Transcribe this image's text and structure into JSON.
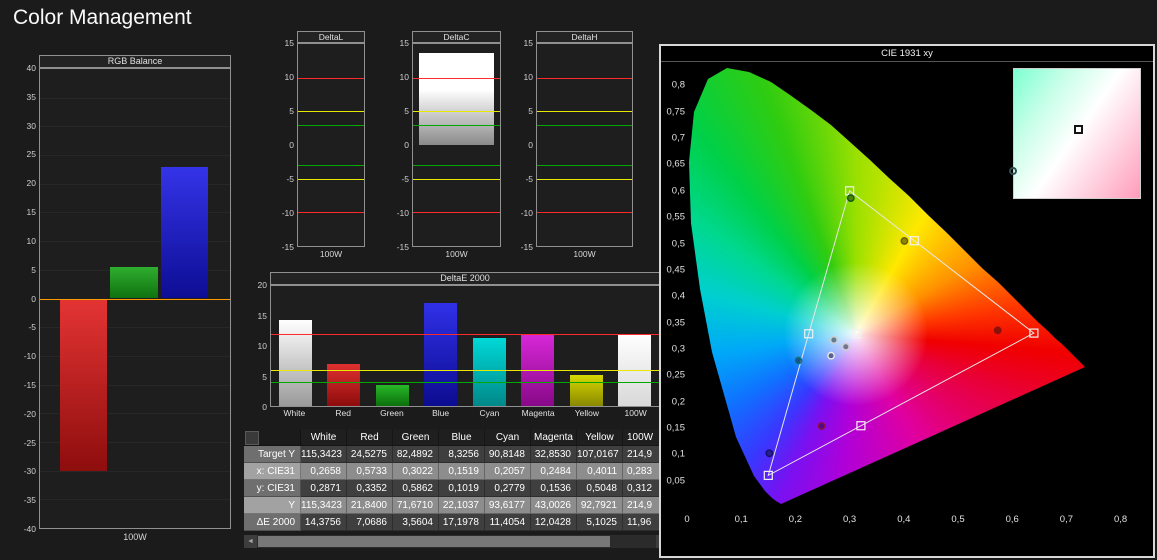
{
  "page_title": "Color Management",
  "colors": {
    "background": "#1b1b1b",
    "panel_border": "#909090",
    "cie_border": "#d8d8d8",
    "zero_line": "#ff9900",
    "limit_red": "#ff2a2a",
    "limit_yellow": "#e8e800",
    "limit_green": "#00a800"
  },
  "rgb_balance": {
    "title": "RGB Balance",
    "x_label": "100W",
    "y_max": 40,
    "y_min": -40,
    "y_step": 5,
    "bars": [
      {
        "name": "red",
        "value": -30,
        "color_light": "#e43434",
        "color_dark": "#8e0d0d"
      },
      {
        "name": "green",
        "value": 5.5,
        "color_light": "#2fae2f",
        "color_dark": "#107110"
      },
      {
        "name": "blue",
        "value": 23,
        "color_light": "#3434e8",
        "color_dark": "#0d0d94"
      }
    ]
  },
  "delta_charts": [
    {
      "title": "DeltaL",
      "x_label": "100W",
      "y_max": 15,
      "y_min": -15,
      "y_step": 5,
      "value": 0,
      "bar_color": [
        "#ffffff",
        "#909090"
      ],
      "thresholds": {
        "red": 10,
        "yellow": 5,
        "green": 3
      }
    },
    {
      "title": "DeltaC",
      "x_label": "100W",
      "y_max": 15,
      "y_min": -15,
      "y_step": 5,
      "value": 13.7,
      "bar_color": [
        "#ffffff",
        "#8a8a8a"
      ],
      "thresholds": {
        "red": 10,
        "yellow": 5,
        "green": 3
      }
    },
    {
      "title": "DeltaH",
      "x_label": "100W",
      "y_max": 15,
      "y_min": -15,
      "y_step": 5,
      "value": 0,
      "bar_color": [
        "#ffffff",
        "#909090"
      ],
      "thresholds": {
        "red": 10,
        "yellow": 5,
        "green": 3
      }
    }
  ],
  "delta_e_chart": {
    "title": "DeltaE 2000",
    "y_max": 20,
    "y_min": 0,
    "y_step": 5,
    "thresholds": {
      "red": 12,
      "yellow": 6,
      "green": 4
    },
    "categories": [
      "White",
      "Red",
      "Green",
      "Blue",
      "Cyan",
      "Magenta",
      "Yellow",
      "100W"
    ],
    "values": [
      14.3756,
      7.0686,
      3.5604,
      17.1978,
      11.4054,
      12.0428,
      5.1025,
      11.96
    ],
    "bar_colors": [
      [
        "#ffffff",
        "#9a9a9a"
      ],
      [
        "#e03030",
        "#8d0c0c"
      ],
      [
        "#28b828",
        "#0c700c"
      ],
      [
        "#3030e8",
        "#0c0c90"
      ],
      [
        "#00d8d8",
        "#008888"
      ],
      [
        "#d828d8",
        "#880888"
      ],
      [
        "#d8d800",
        "#888800"
      ],
      [
        "#ffffff",
        "#d8d8d8"
      ]
    ]
  },
  "table": {
    "columns": [
      "",
      "White",
      "Red",
      "Green",
      "Blue",
      "Cyan",
      "Magenta",
      "Yellow",
      "100W"
    ],
    "rows": [
      {
        "label": "Target Y",
        "values": [
          "115,3423",
          "24,5275",
          "82,4892",
          "8,3256",
          "90,8148",
          "32,8530",
          "107,0167",
          "214,9"
        ]
      },
      {
        "label": "x: CIE31",
        "values": [
          "0,2658",
          "0,5733",
          "0,3022",
          "0,1519",
          "0,2057",
          "0,2484",
          "0,4011",
          "0,283"
        ]
      },
      {
        "label": "y: CIE31",
        "values": [
          "0,2871",
          "0,3352",
          "0,5862",
          "0,1019",
          "0,2779",
          "0,1536",
          "0,5048",
          "0,312"
        ]
      },
      {
        "label": "Y",
        "values": [
          "115,3423",
          "21,8400",
          "71,6710",
          "22,1037",
          "93,6177",
          "43,0026",
          "92,7921",
          "214,9"
        ]
      },
      {
        "label": "ΔE 2000",
        "values": [
          "14,3756",
          "7,0686",
          "3,5604",
          "17,1978",
          "11,4054",
          "12,0428",
          "5,1025",
          "11,96"
        ]
      }
    ]
  },
  "cie_chart": {
    "title": "CIE 1931 xy",
    "x_ticks": [
      "0",
      "0,1",
      "0,2",
      "0,3",
      "0,4",
      "0,5",
      "0,6",
      "0,7",
      "0,8"
    ],
    "y_ticks": [
      "0,8",
      "0,75",
      "0,7",
      "0,65",
      "0,6",
      "0,55",
      "0,5",
      "0,45",
      "0,4",
      "0,35",
      "0,3",
      "0,25",
      "0,2",
      "0,15",
      "0,1",
      "0,05"
    ],
    "gamut_triangle": {
      "red": [
        0.64,
        0.33
      ],
      "green": [
        0.3,
        0.6
      ],
      "blue": [
        0.15,
        0.06
      ]
    },
    "reference_points": [
      {
        "name": "White",
        "x": 0.3127,
        "y": 0.329
      },
      {
        "name": "Red",
        "x": 0.64,
        "y": 0.33
      },
      {
        "name": "Green",
        "x": 0.3,
        "y": 0.6
      },
      {
        "name": "Blue",
        "x": 0.15,
        "y": 0.06
      },
      {
        "name": "Cyan",
        "x": 0.2246,
        "y": 0.3287
      },
      {
        "name": "Magenta",
        "x": 0.3209,
        "y": 0.1542
      },
      {
        "name": "Yellow",
        "x": 0.4193,
        "y": 0.5053
      }
    ],
    "measured_points": [
      {
        "name": "White",
        "x": 0.2658,
        "y": 0.2871,
        "color": "#e8e8e8"
      },
      {
        "name": "Red",
        "x": 0.5733,
        "y": 0.3352,
        "color": "#8d1010"
      },
      {
        "name": "Green",
        "x": 0.3022,
        "y": 0.5862,
        "color": "#0a5c0a"
      },
      {
        "name": "Blue",
        "x": 0.1519,
        "y": 0.1019,
        "color": "#10106a"
      },
      {
        "name": "Cyan",
        "x": 0.2057,
        "y": 0.2779,
        "color": "#0a7878"
      },
      {
        "name": "Magenta",
        "x": 0.2484,
        "y": 0.1536,
        "color": "#8d1040"
      },
      {
        "name": "Yellow",
        "x": 0.4011,
        "y": 0.5048,
        "color": "#6a5c0a"
      },
      {
        "name": "Gray1",
        "x": 0.271,
        "y": 0.317,
        "color": "#cccccc"
      },
      {
        "name": "Gray2",
        "x": 0.293,
        "y": 0.304,
        "color": "#cccccc"
      }
    ]
  }
}
